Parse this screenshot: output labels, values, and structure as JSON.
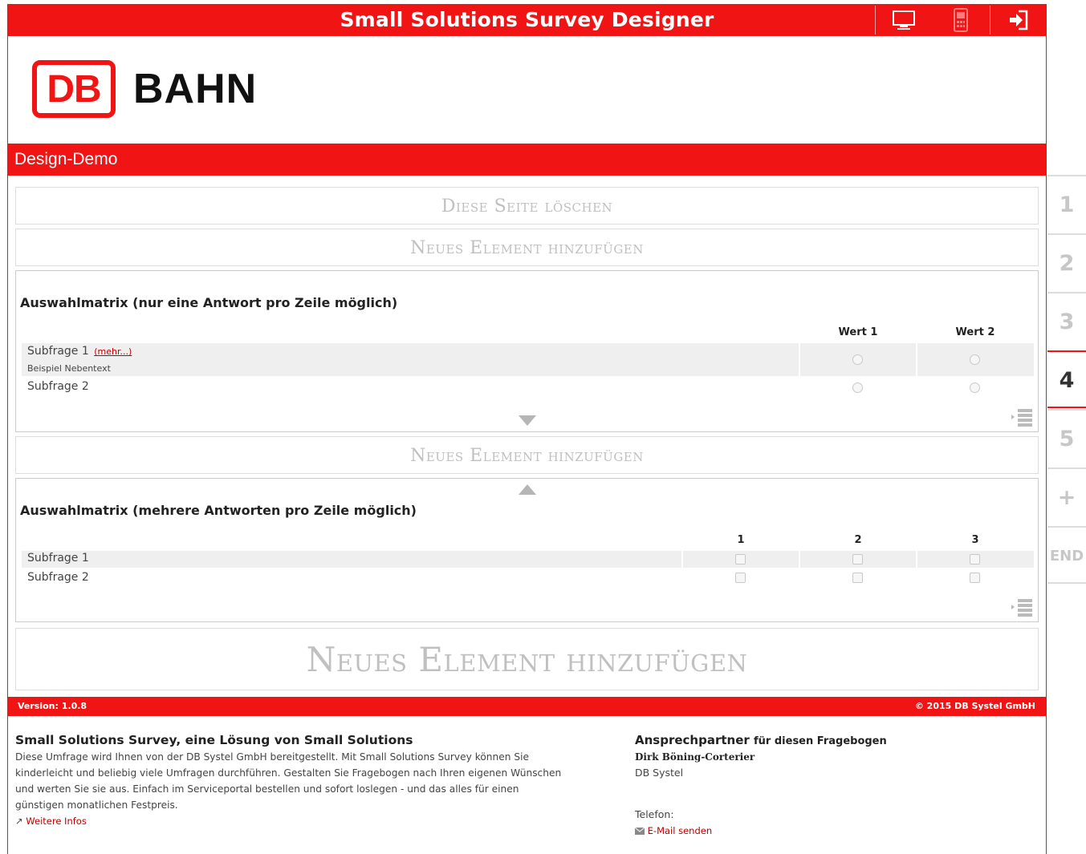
{
  "topbar": {
    "title": "Small Solutions Survey Designer",
    "buttons": [
      {
        "icon": "desktop-icon"
      },
      {
        "icon": "mobile-icon"
      },
      {
        "icon": "logout-icon"
      }
    ]
  },
  "logo": {
    "mark": "DB",
    "text": "BAHN"
  },
  "survey": {
    "name": "Design-Demo"
  },
  "actions": {
    "delete_page": "Diese Seite löschen",
    "add_element": "Neues Element hinzufügen"
  },
  "matrix1": {
    "title": "Auswahlmatrix (nur eine Antwort pro Zeile möglich)",
    "columns": [
      "Wert 1",
      "Wert 2"
    ],
    "rows": [
      {
        "label": "Subfrage 1",
        "more": "(mehr...)",
        "subtext": "Beispiel Nebentext"
      },
      {
        "label": "Subfrage 2"
      }
    ]
  },
  "matrix2": {
    "title": "Auswahlmatrix (mehrere Antworten pro Zeile möglich)",
    "columns": [
      "1",
      "2",
      "3"
    ],
    "rows": [
      {
        "label": "Subfrage 1"
      },
      {
        "label": "Subfrage 2"
      }
    ]
  },
  "footer": {
    "version": "Version: 1.0.8",
    "copyright": "© 2015 DB Systel GmbH",
    "about_title": "Small Solutions Survey, eine Lösung von Small Solutions",
    "about_text": "Diese Umfrage wird Ihnen von der DB Systel GmbH bereitgestellt. Mit Small Solutions Survey können Sie kinderleicht und beliebig viele Umfragen durchführen. Gestalten Sie Fragebogen nach Ihren eigenen Wünschen und werten Sie sie aus. Einfach im Serviceportal bestellen und sofort loslegen - und das alles für einen günstigen monatlichen Festpreis.",
    "more_info": "Weitere Infos",
    "contact_title": "Ansprechpartner",
    "contact_title_suffix": "für diesen Fragebogen",
    "contact_name": "Dirk Böning-Corterier",
    "contact_org": "DB Systel",
    "phone_label": "Telefon:",
    "email_label": "E-Mail senden"
  },
  "pages": {
    "items": [
      "1",
      "2",
      "3",
      "4",
      "5",
      "+",
      "END"
    ],
    "active": "4"
  },
  "colors": {
    "brand": "#f01414"
  }
}
